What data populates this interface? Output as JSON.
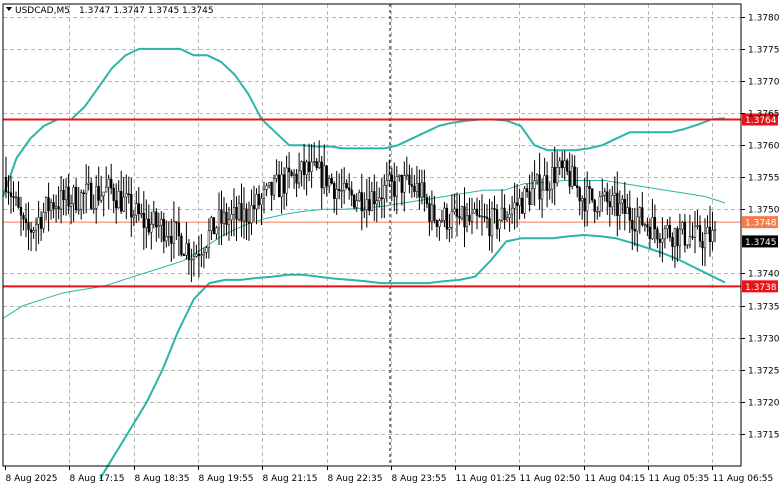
{
  "header": {
    "symbol": "USDCAD,M5",
    "ohlc": "1.3747 1.3747 1.3745 1.3745"
  },
  "chart_data": {
    "type": "candlestick",
    "symbol": "USDCAD",
    "timeframe": "M5",
    "ylim": [
      1.371,
      1.3782
    ],
    "y_ticks": [
      "1.3780",
      "1.3775",
      "1.3770",
      "1.3765",
      "1.3760",
      "1.3755",
      "1.3750",
      "1.3740",
      "1.3735",
      "1.3730",
      "1.3725",
      "1.3720",
      "1.3715"
    ],
    "y_tick_values": [
      1.378,
      1.3775,
      1.377,
      1.3765,
      1.376,
      1.3755,
      1.375,
      1.374,
      1.3735,
      1.373,
      1.3725,
      1.372,
      1.3715
    ],
    "x_ticks": [
      "8 Aug 2025",
      "8 Aug 17:15",
      "8 Aug 18:35",
      "8 Aug 19:55",
      "8 Aug 21:15",
      "8 Aug 22:35",
      "8 Aug 23:55",
      "11 Aug 01:25",
      "11 Aug 02:50",
      "11 Aug 04:15",
      "11 Aug 05:35",
      "11 Aug 06:55"
    ],
    "grid": true,
    "levels": [
      {
        "label": "1.3764",
        "value": 1.3764,
        "color": "#e8131a",
        "style": "thick"
      },
      {
        "label": "1.3748",
        "value": 1.3748,
        "color": "#f57b4c",
        "style": "thin"
      },
      {
        "label": "1.3738",
        "value": 1.3738,
        "color": "#e8131a",
        "style": "thick"
      }
    ],
    "current_price": {
      "label": "1.3745",
      "value": 1.3745
    },
    "colors": {
      "candle": "#000000",
      "bollinger": "#2ab5a5",
      "moving_average": "#2ab5a5",
      "level": "#e8131a",
      "current": "#000000"
    },
    "bollinger_upper": [
      1.3752,
      1.3758,
      1.3761,
      1.3763,
      1.3764,
      1.3764,
      1.3766,
      1.3769,
      1.3772,
      1.3774,
      1.3775,
      1.3775,
      1.3775,
      1.3775,
      1.3774,
      1.3774,
      1.3773,
      1.3771,
      1.3768,
      1.3764,
      1.3762,
      1.376,
      1.376,
      1.37598,
      1.37598,
      1.37595,
      1.37595,
      1.37595,
      1.37595,
      1.376,
      1.3761,
      1.3762,
      1.3763,
      1.37635,
      1.37638,
      1.3764,
      1.3764,
      1.37638,
      1.3763,
      1.376,
      1.37592,
      1.37592,
      1.37592,
      1.37595,
      1.376,
      1.3761,
      1.3762,
      1.3762,
      1.3762,
      1.3762,
      1.37625,
      1.37632,
      1.3764,
      1.37642
    ],
    "bollinger_lower": [
      1.3708,
      1.3712,
      1.3716,
      1.372,
      1.3725,
      1.3731,
      1.3736,
      1.37385,
      1.3739,
      1.3739,
      1.37393,
      1.37395,
      1.37398,
      1.37398,
      1.37395,
      1.37392,
      1.3739,
      1.37388,
      1.37385,
      1.37385,
      1.37385,
      1.37385,
      1.37388,
      1.3739,
      1.37395,
      1.3742,
      1.3745,
      1.37455,
      1.37455,
      1.37455,
      1.37458,
      1.3746,
      1.37458,
      1.37455,
      1.37448,
      1.3744,
      1.37432,
      1.37422,
      1.3741,
      1.37398,
      1.37386
    ],
    "moving_average": [
      1.3733,
      1.3735,
      1.3736,
      1.3737,
      1.37375,
      1.3738,
      1.3739,
      1.374,
      1.3741,
      1.3742,
      1.3744,
      1.3746,
      1.37475,
      1.37485,
      1.37492,
      1.37497,
      1.375,
      1.375,
      1.37502,
      1.37505,
      1.3751,
      1.37515,
      1.3752,
      1.37525,
      1.3753,
      1.3753,
      1.3754,
      1.37542,
      1.37545,
      1.37545,
      1.37545,
      1.3754,
      1.37535,
      1.3753,
      1.37525,
      1.3752,
      1.3751
    ]
  }
}
